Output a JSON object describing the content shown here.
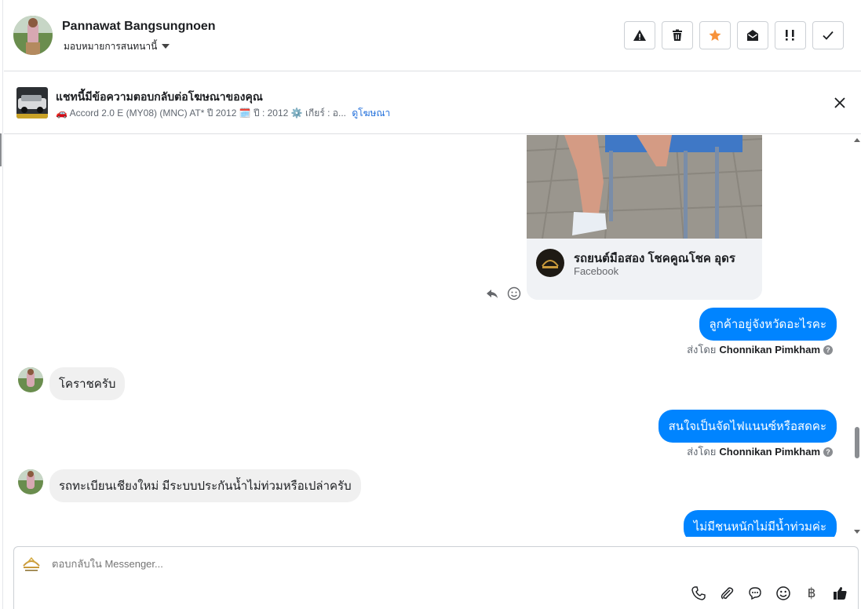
{
  "header": {
    "customer_name": "Pannawat Bangsungnoen",
    "assign_label": "มอบหมายการสนทนานี้",
    "actions": [
      {
        "name": "report-spam-button",
        "icon": "warning-icon"
      },
      {
        "name": "delete-button",
        "icon": "trash-icon"
      },
      {
        "name": "follow-up-button",
        "icon": "star-icon",
        "color": "#f7923b"
      },
      {
        "name": "mark-unread-button",
        "icon": "open-envelope-icon"
      },
      {
        "name": "mark-priority-button",
        "icon": "exclamation-icon"
      },
      {
        "name": "mark-done-button",
        "icon": "check-icon"
      }
    ]
  },
  "ad_banner": {
    "title": "แชทนี้มีข้อความตอบกลับต่อโฆษณาของคุณ",
    "summary": "🚗 Accord 2.0 E (MY08) (MNC) AT* ปี 2012 🗓️ ปี : 2012 ⚙️ เกียร์ : อ...",
    "view_ad_link": "ดูโฆษณา"
  },
  "shared_post": {
    "page_name": "รถยนต์มือสอง โชคคูณโชค อุดร",
    "source": "Facebook"
  },
  "messages": [
    {
      "direction": "out",
      "text": "ลูกค้าอยู่จังหวัดอะไรคะ",
      "sent_by_label": "ส่งโดย",
      "sender": "Chonnikan Pimkham"
    },
    {
      "direction": "in",
      "text": "โคราชครับ"
    },
    {
      "direction": "out",
      "text": "สนใจเป็นจัดไฟแนนซ์หรือสดคะ",
      "sent_by_label": "ส่งโดย",
      "sender": "Chonnikan Pimkham"
    },
    {
      "direction": "in",
      "text": "รถทะเบียนเชียงใหม่ มีระบบประกันน้ำไม่ท่วมหรือเปล่าครับ"
    },
    {
      "direction": "out",
      "text": "ไม่มีชนหนักไม่มีน้ำท่วมค่ะ"
    }
  ],
  "composer": {
    "placeholder": "ตอบกลับใน Messenger...",
    "tools": [
      "phone-icon",
      "attachment-icon",
      "saved-reply-icon",
      "emoji-icon",
      "baht-icon",
      "thumbs-up-icon"
    ]
  },
  "colors": {
    "outgoing_bubble": "#0084ff",
    "incoming_bubble": "#f0f0f0",
    "link": "#216fdb"
  }
}
